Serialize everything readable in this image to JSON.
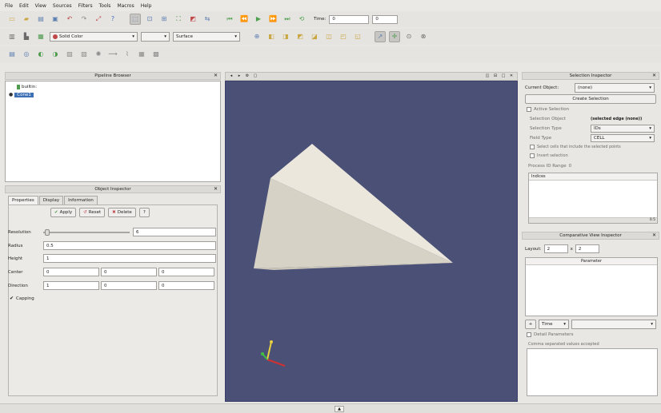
{
  "menubar": [
    "File",
    "Edit",
    "View",
    "Sources",
    "Filters",
    "Tools",
    "Macros",
    "Help"
  ],
  "toolbar1": {
    "time_label": "Time:",
    "time_value": "0",
    "time_index": "0"
  },
  "toolbar2": {
    "color_select": "Solid Color",
    "color_arrow": "▾",
    "representation_select": "Surface"
  },
  "pipeline": {
    "title": "Pipeline Browser",
    "builtin": "builtin:",
    "item": "Cone1"
  },
  "object_inspector": {
    "title": "Object Inspector",
    "tabs": [
      "Properties",
      "Display",
      "Information"
    ],
    "apply": "Apply",
    "reset": "Reset",
    "delete": "Delete",
    "help": "?",
    "props": {
      "resolution_label": "Resolution",
      "resolution_value": "6",
      "radius_label": "Radius",
      "radius_value": "0.5",
      "height_label": "Height",
      "height_value": "1",
      "center_label": "Center",
      "center_values": [
        "0",
        "0",
        "0"
      ],
      "direction_label": "Direction",
      "direction_values": [
        "1",
        "0",
        "0"
      ],
      "capping_label": "Capping"
    }
  },
  "selection_inspector": {
    "title": "Selection Inspector",
    "current_object_label": "Current Object:",
    "current_object_value": "(none)",
    "create_selection": "Create Selection",
    "active_selection": "Active Selection",
    "selection_object_label": "Selection Object",
    "selection_object_value": "(selected edge (none))",
    "selection_type_label": "Selection Type",
    "selection_type_value": "IDs",
    "field_type_label": "Field Type",
    "field_type_value": "CELL",
    "cb1": "Select cells that include the selected points",
    "cb2": "Invert selection",
    "process_id_label": "Process ID Range",
    "process_id_value": "0",
    "list_header": "Indices",
    "list_scroll_label": "0.5"
  },
  "comparative_inspector": {
    "title": "Comparative View Inspector",
    "layout_label": "Layout:",
    "layout_x": "2",
    "layout_sep": "x",
    "layout_y": "2",
    "params_header": "Parameter",
    "time_select": "Time",
    "plus": "+",
    "dots": "...",
    "detail_label": "Detail Parameters",
    "detail_text": "Comma separated values accepted"
  },
  "viewport": {
    "axis_x_color": "#d03030",
    "axis_y_color": "#e8d040",
    "axis_z_color": "#40c040",
    "bg_color": "#4b5077",
    "cone_light": "#ebe7dc",
    "cone_mid": "#d9d5ca",
    "cone_dark": "#c8c4b8"
  },
  "statusbar": {
    "indicator": "▲"
  }
}
